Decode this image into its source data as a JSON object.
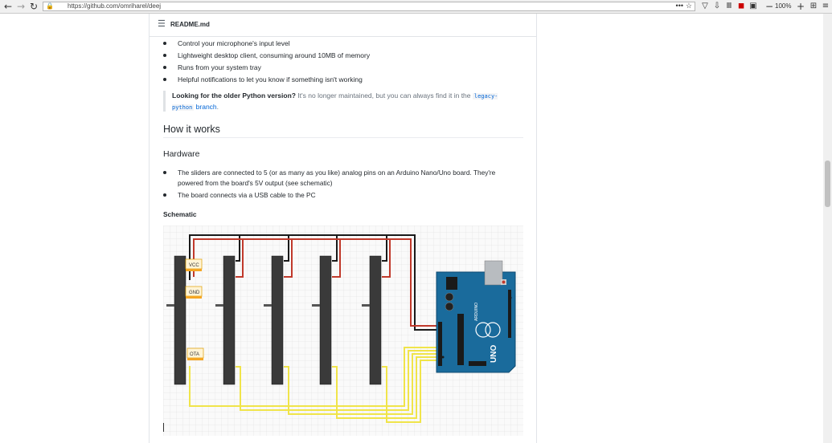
{
  "browser": {
    "url": "https://github.com/omriharel/deej",
    "zoom": "100%"
  },
  "readme": {
    "filename": "README.md",
    "features": [
      "Control your microphone's input level",
      "Lightweight desktop client, consuming around 10MB of memory",
      "Runs from your system tray",
      "Helpful notifications to let you know if something isn't working"
    ],
    "quote": {
      "bold": "Looking for the older Python version?",
      "text": " It's no longer maintained, but you can always find it in the ",
      "code": "legacy-python",
      "link": "branch",
      "end": "."
    },
    "how_heading": "How it works",
    "hardware_heading": "Hardware",
    "hardware_items": [
      "The sliders are connected to 5 (or as many as you like) analog pins on an Arduino Nano/Uno board. They're",
      "powered from the board's 5V output (see schematic)",
      "The board connects via a USB cable to the PC"
    ],
    "schematic_heading": "Schematic",
    "schematic_labels": {
      "vcc": "VCC",
      "gnd": "GND",
      "ota": "OTA",
      "board_name": "UNO",
      "board_brand": "ARDUINO"
    }
  },
  "colors": {
    "wire_red": "#c0392b",
    "wire_black": "#1a1a1a",
    "wire_yellow": "#f0e44a",
    "arduino_blue": "#1a6b9c",
    "link": "#0366d6"
  }
}
